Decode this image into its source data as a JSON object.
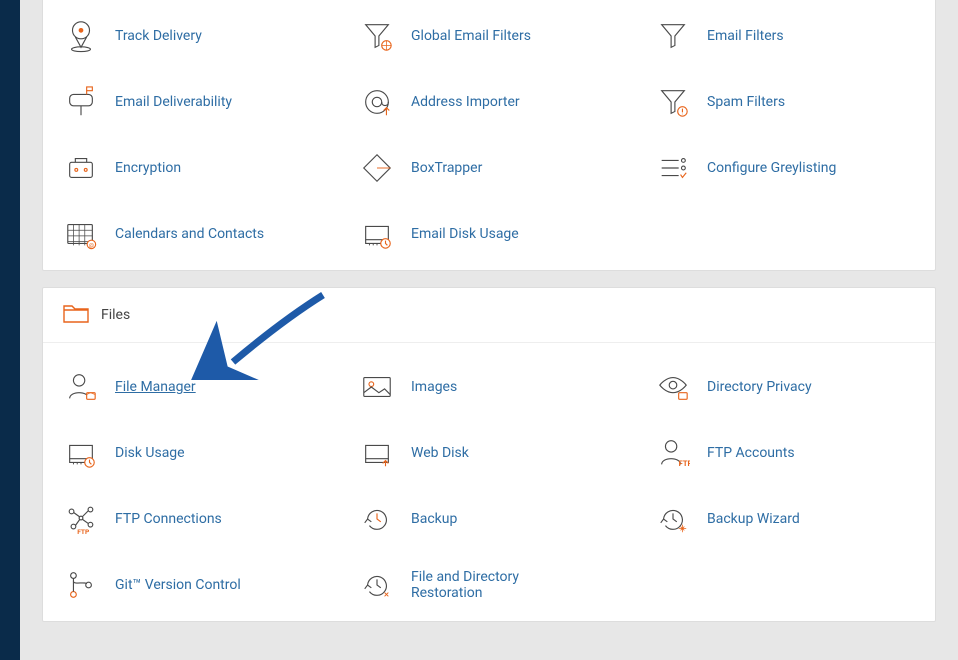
{
  "email_section": {
    "rows": [
      {
        "items": [
          {
            "id": "track-delivery",
            "label": "Track Delivery",
            "icon": "pin"
          },
          {
            "id": "global-email-filters",
            "label": "Global Email Filters",
            "icon": "funnel-globe"
          },
          {
            "id": "email-filters",
            "label": "Email Filters",
            "icon": "funnel"
          }
        ]
      },
      {
        "items": [
          {
            "id": "email-deliverability",
            "label": "Email Deliverability",
            "icon": "mailbox"
          },
          {
            "id": "address-importer",
            "label": "Address Importer",
            "icon": "at-up"
          },
          {
            "id": "spam-filters",
            "label": "Spam Filters",
            "icon": "funnel-alert"
          }
        ]
      },
      {
        "items": [
          {
            "id": "encryption",
            "label": "Encryption",
            "icon": "briefcase"
          },
          {
            "id": "boxtrapper",
            "label": "BoxTrapper",
            "icon": "diamond"
          },
          {
            "id": "configure-greylisting",
            "label": "Configure Greylisting",
            "icon": "list-check"
          }
        ]
      },
      {
        "items": [
          {
            "id": "calendars-contacts",
            "label": "Calendars and Contacts",
            "icon": "calendar-at"
          },
          {
            "id": "email-disk-usage",
            "label": "Email Disk Usage",
            "icon": "disk-clock"
          }
        ]
      }
    ]
  },
  "files_section": {
    "title": "Files",
    "rows": [
      {
        "items": [
          {
            "id": "file-manager",
            "label": "File Manager",
            "icon": "user-folder",
            "highlight": true
          },
          {
            "id": "images",
            "label": "Images",
            "icon": "image"
          },
          {
            "id": "directory-privacy",
            "label": "Directory Privacy",
            "icon": "eye-folder"
          }
        ]
      },
      {
        "items": [
          {
            "id": "disk-usage",
            "label": "Disk Usage",
            "icon": "disk-clock"
          },
          {
            "id": "web-disk",
            "label": "Web Disk",
            "icon": "disk-arrow"
          },
          {
            "id": "ftp-accounts",
            "label": "FTP Accounts",
            "icon": "user-ftp"
          }
        ]
      },
      {
        "items": [
          {
            "id": "ftp-connections",
            "label": "FTP Connections",
            "icon": "network-ftp"
          },
          {
            "id": "backup",
            "label": "Backup",
            "icon": "clock-arrow"
          },
          {
            "id": "backup-wizard",
            "label": "Backup Wizard",
            "icon": "clock-sparkle"
          }
        ]
      },
      {
        "items": [
          {
            "id": "git-version-control",
            "label": "Git™ Version Control",
            "icon": "git"
          },
          {
            "id": "file-directory-restoration",
            "label": "File and Directory Restoration",
            "icon": "clock-restore"
          }
        ]
      }
    ]
  },
  "colors": {
    "accent": "#e8641b",
    "link": "#2e6da4",
    "stroke": "#4a4a4a"
  }
}
